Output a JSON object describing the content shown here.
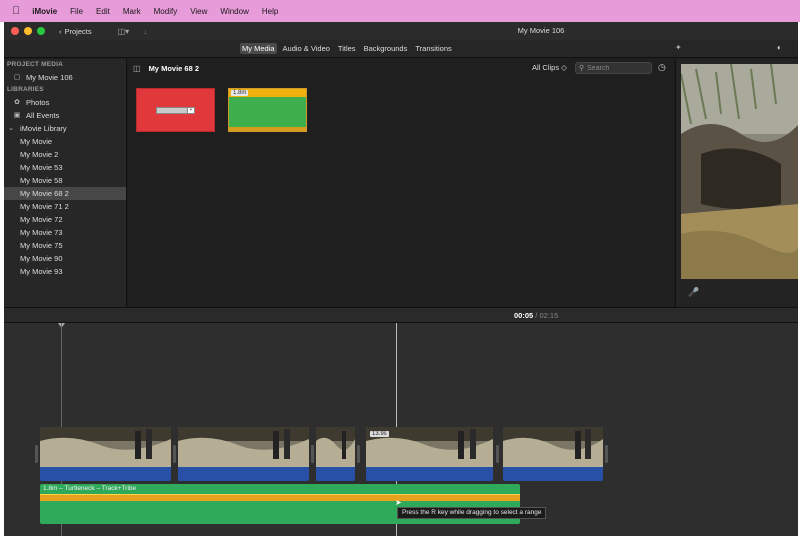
{
  "menubar": {
    "apple_icon": "apple-icon",
    "items": [
      "iMovie",
      "File",
      "Edit",
      "Mark",
      "Modify",
      "View",
      "Window",
      "Help"
    ]
  },
  "titlebar": {
    "projects_label": "Projects",
    "title": "My Movie 106"
  },
  "tabs": [
    "My Media",
    "Audio & Video",
    "Titles",
    "Backgrounds",
    "Transitions"
  ],
  "sidebar": {
    "project_media_header": "PROJECT MEDIA",
    "project_item": "My Movie 106",
    "libraries_header": "LIBRARIES",
    "photos": "Photos",
    "all_events": "All Events",
    "library": "iMovie Library",
    "events": [
      "My Movie",
      "My Movie 2",
      "My Movie 53",
      "My Movie 58",
      "My Movie 68 2",
      "My Movie 71 2",
      "My Movie 72",
      "My Movie 73",
      "My Movie 75",
      "My Movie 90",
      "My Movie 93"
    ],
    "selected_index": 4
  },
  "browser": {
    "title": "My Movie 68 2",
    "filter": "All Clips ◇",
    "search_placeholder": "Search",
    "clips": [
      {
        "type": "title",
        "color": "#e1383b"
      },
      {
        "type": "audio",
        "duration": "1.8m",
        "color": "#3fae4c"
      }
    ]
  },
  "timeline": {
    "current": "00:05",
    "separator": "/",
    "total": "02:15",
    "clip_badge": "13.9s",
    "audio_label": "1.8m – Turtleneck – Track+Tribe",
    "tooltip": "Press the R key while dragging to select a range"
  },
  "colors": {
    "menubar": "#e79bd9",
    "audio": "#2fa95a",
    "video_strip": "#2850a6",
    "title_clip": "#e1383b"
  }
}
